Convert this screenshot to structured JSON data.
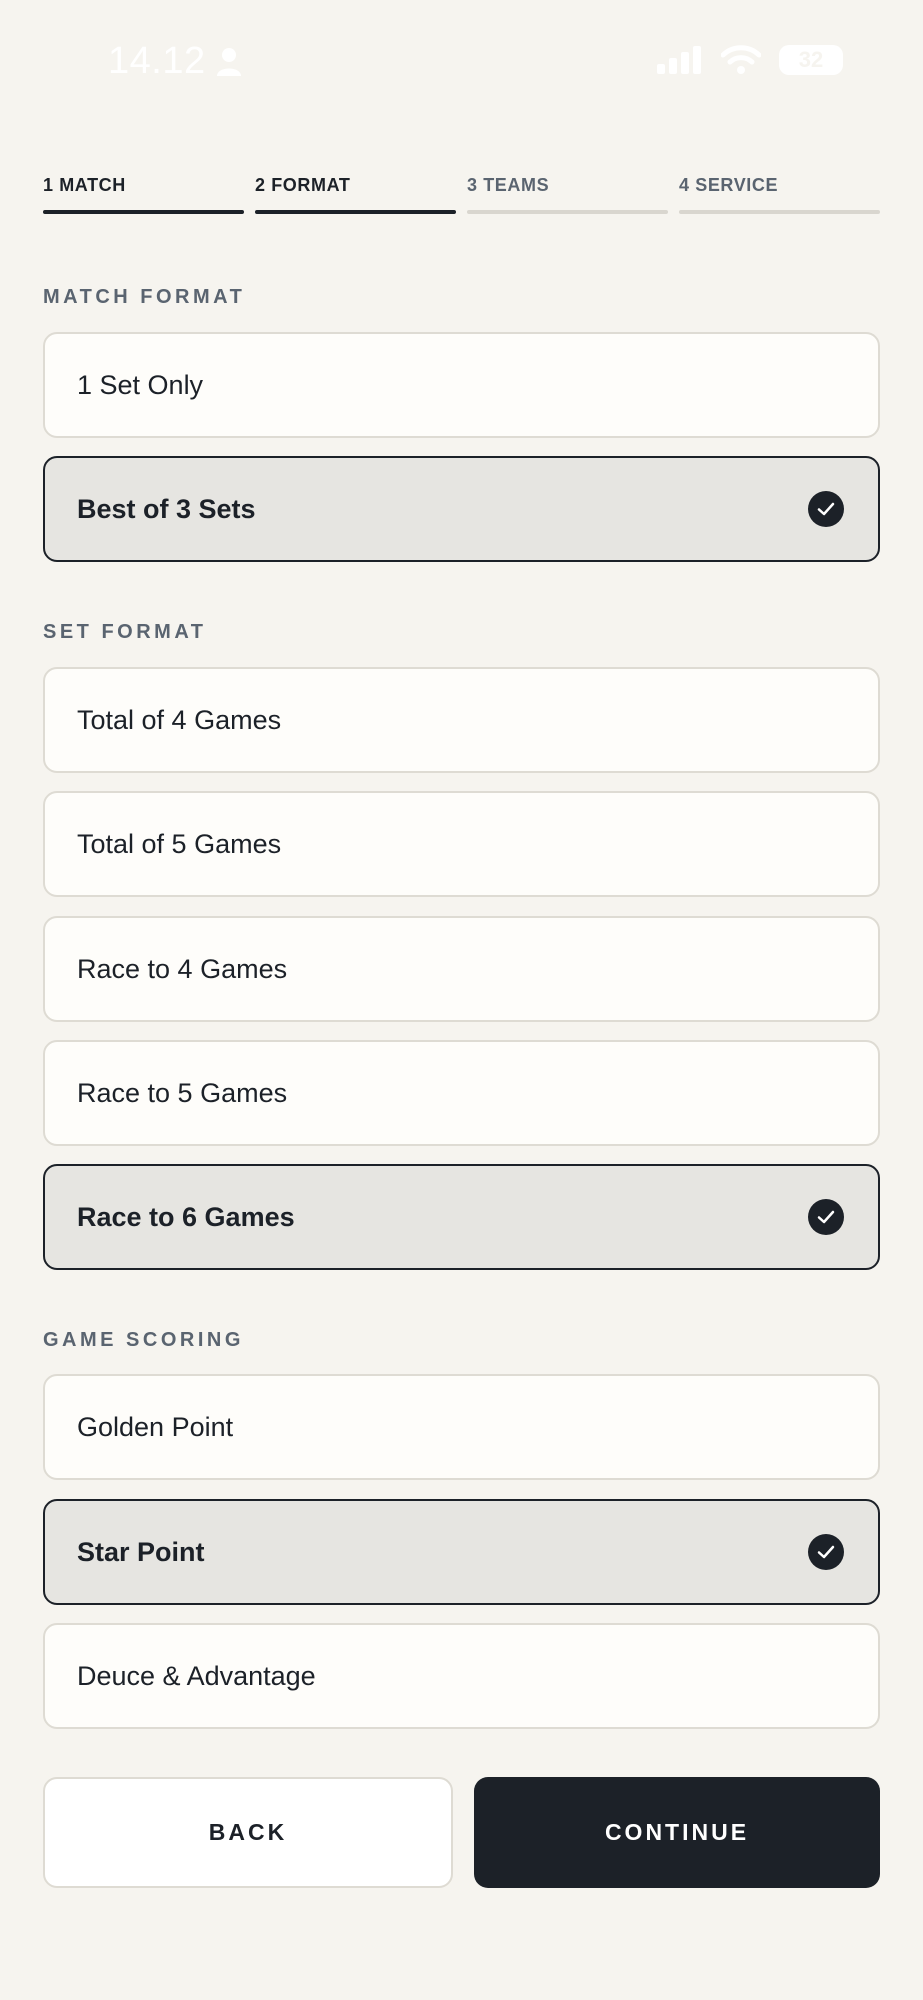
{
  "status_bar": {
    "time": "14.12",
    "battery": "32",
    "colors": {
      "text": "#ffffff"
    }
  },
  "steps": [
    {
      "label": "1 MATCH",
      "state": "complete"
    },
    {
      "label": "2 FORMAT",
      "state": "active"
    },
    {
      "label": "3 TEAMS",
      "state": "pending"
    },
    {
      "label": "4 SERVICE",
      "state": "pending"
    }
  ],
  "match_format": {
    "title": "MATCH FORMAT",
    "options": [
      {
        "label": "1 Set Only",
        "selected": false
      },
      {
        "label": "Best of 3 Sets",
        "selected": true
      }
    ]
  },
  "set_format": {
    "title": "SET FORMAT",
    "options": [
      {
        "label": "Total of 4 Games",
        "selected": false
      },
      {
        "label": "Total of 5 Games",
        "selected": false
      },
      {
        "label": "Race to 4 Games",
        "selected": false
      },
      {
        "label": "Race to 5 Games",
        "selected": false
      },
      {
        "label": "Race to 6 Games",
        "selected": true
      }
    ]
  },
  "game_scoring": {
    "title": "GAME SCORING",
    "options": [
      {
        "label": "Golden Point",
        "selected": false
      },
      {
        "label": "Star Point",
        "selected": true
      },
      {
        "label": "Deuce & Advantage",
        "selected": false
      }
    ]
  },
  "actions": {
    "back_label": "BACK",
    "continue_label": "CONTINUE"
  },
  "colors": {
    "background": "#f6f4ef",
    "primary": "#1c2128",
    "muted": "#5a6470",
    "pending_bar": "#d9d6cf",
    "selected_bg": "#e6e5e1"
  }
}
